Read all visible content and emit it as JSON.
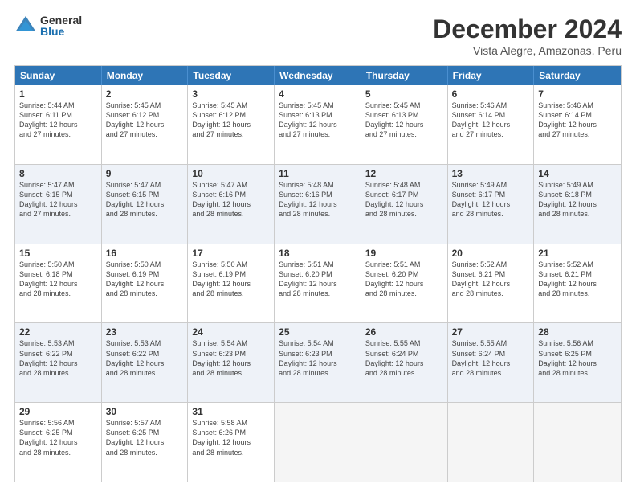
{
  "logo": {
    "general": "General",
    "blue": "Blue"
  },
  "header": {
    "title": "December 2024",
    "subtitle": "Vista Alegre, Amazonas, Peru"
  },
  "weekdays": [
    "Sunday",
    "Monday",
    "Tuesday",
    "Wednesday",
    "Thursday",
    "Friday",
    "Saturday"
  ],
  "rows": [
    [
      {
        "day": "1",
        "info": "Sunrise: 5:44 AM\nSunset: 6:11 PM\nDaylight: 12 hours\nand 27 minutes."
      },
      {
        "day": "2",
        "info": "Sunrise: 5:45 AM\nSunset: 6:12 PM\nDaylight: 12 hours\nand 27 minutes."
      },
      {
        "day": "3",
        "info": "Sunrise: 5:45 AM\nSunset: 6:12 PM\nDaylight: 12 hours\nand 27 minutes."
      },
      {
        "day": "4",
        "info": "Sunrise: 5:45 AM\nSunset: 6:13 PM\nDaylight: 12 hours\nand 27 minutes."
      },
      {
        "day": "5",
        "info": "Sunrise: 5:45 AM\nSunset: 6:13 PM\nDaylight: 12 hours\nand 27 minutes."
      },
      {
        "day": "6",
        "info": "Sunrise: 5:46 AM\nSunset: 6:14 PM\nDaylight: 12 hours\nand 27 minutes."
      },
      {
        "day": "7",
        "info": "Sunrise: 5:46 AM\nSunset: 6:14 PM\nDaylight: 12 hours\nand 27 minutes."
      }
    ],
    [
      {
        "day": "8",
        "info": "Sunrise: 5:47 AM\nSunset: 6:15 PM\nDaylight: 12 hours\nand 27 minutes."
      },
      {
        "day": "9",
        "info": "Sunrise: 5:47 AM\nSunset: 6:15 PM\nDaylight: 12 hours\nand 28 minutes."
      },
      {
        "day": "10",
        "info": "Sunrise: 5:47 AM\nSunset: 6:16 PM\nDaylight: 12 hours\nand 28 minutes."
      },
      {
        "day": "11",
        "info": "Sunrise: 5:48 AM\nSunset: 6:16 PM\nDaylight: 12 hours\nand 28 minutes."
      },
      {
        "day": "12",
        "info": "Sunrise: 5:48 AM\nSunset: 6:17 PM\nDaylight: 12 hours\nand 28 minutes."
      },
      {
        "day": "13",
        "info": "Sunrise: 5:49 AM\nSunset: 6:17 PM\nDaylight: 12 hours\nand 28 minutes."
      },
      {
        "day": "14",
        "info": "Sunrise: 5:49 AM\nSunset: 6:18 PM\nDaylight: 12 hours\nand 28 minutes."
      }
    ],
    [
      {
        "day": "15",
        "info": "Sunrise: 5:50 AM\nSunset: 6:18 PM\nDaylight: 12 hours\nand 28 minutes."
      },
      {
        "day": "16",
        "info": "Sunrise: 5:50 AM\nSunset: 6:19 PM\nDaylight: 12 hours\nand 28 minutes."
      },
      {
        "day": "17",
        "info": "Sunrise: 5:50 AM\nSunset: 6:19 PM\nDaylight: 12 hours\nand 28 minutes."
      },
      {
        "day": "18",
        "info": "Sunrise: 5:51 AM\nSunset: 6:20 PM\nDaylight: 12 hours\nand 28 minutes."
      },
      {
        "day": "19",
        "info": "Sunrise: 5:51 AM\nSunset: 6:20 PM\nDaylight: 12 hours\nand 28 minutes."
      },
      {
        "day": "20",
        "info": "Sunrise: 5:52 AM\nSunset: 6:21 PM\nDaylight: 12 hours\nand 28 minutes."
      },
      {
        "day": "21",
        "info": "Sunrise: 5:52 AM\nSunset: 6:21 PM\nDaylight: 12 hours\nand 28 minutes."
      }
    ],
    [
      {
        "day": "22",
        "info": "Sunrise: 5:53 AM\nSunset: 6:22 PM\nDaylight: 12 hours\nand 28 minutes."
      },
      {
        "day": "23",
        "info": "Sunrise: 5:53 AM\nSunset: 6:22 PM\nDaylight: 12 hours\nand 28 minutes."
      },
      {
        "day": "24",
        "info": "Sunrise: 5:54 AM\nSunset: 6:23 PM\nDaylight: 12 hours\nand 28 minutes."
      },
      {
        "day": "25",
        "info": "Sunrise: 5:54 AM\nSunset: 6:23 PM\nDaylight: 12 hours\nand 28 minutes."
      },
      {
        "day": "26",
        "info": "Sunrise: 5:55 AM\nSunset: 6:24 PM\nDaylight: 12 hours\nand 28 minutes."
      },
      {
        "day": "27",
        "info": "Sunrise: 5:55 AM\nSunset: 6:24 PM\nDaylight: 12 hours\nand 28 minutes."
      },
      {
        "day": "28",
        "info": "Sunrise: 5:56 AM\nSunset: 6:25 PM\nDaylight: 12 hours\nand 28 minutes."
      }
    ],
    [
      {
        "day": "29",
        "info": "Sunrise: 5:56 AM\nSunset: 6:25 PM\nDaylight: 12 hours\nand 28 minutes."
      },
      {
        "day": "30",
        "info": "Sunrise: 5:57 AM\nSunset: 6:25 PM\nDaylight: 12 hours\nand 28 minutes."
      },
      {
        "day": "31",
        "info": "Sunrise: 5:58 AM\nSunset: 6:26 PM\nDaylight: 12 hours\nand 28 minutes."
      },
      {
        "day": "",
        "info": ""
      },
      {
        "day": "",
        "info": ""
      },
      {
        "day": "",
        "info": ""
      },
      {
        "day": "",
        "info": ""
      }
    ]
  ]
}
